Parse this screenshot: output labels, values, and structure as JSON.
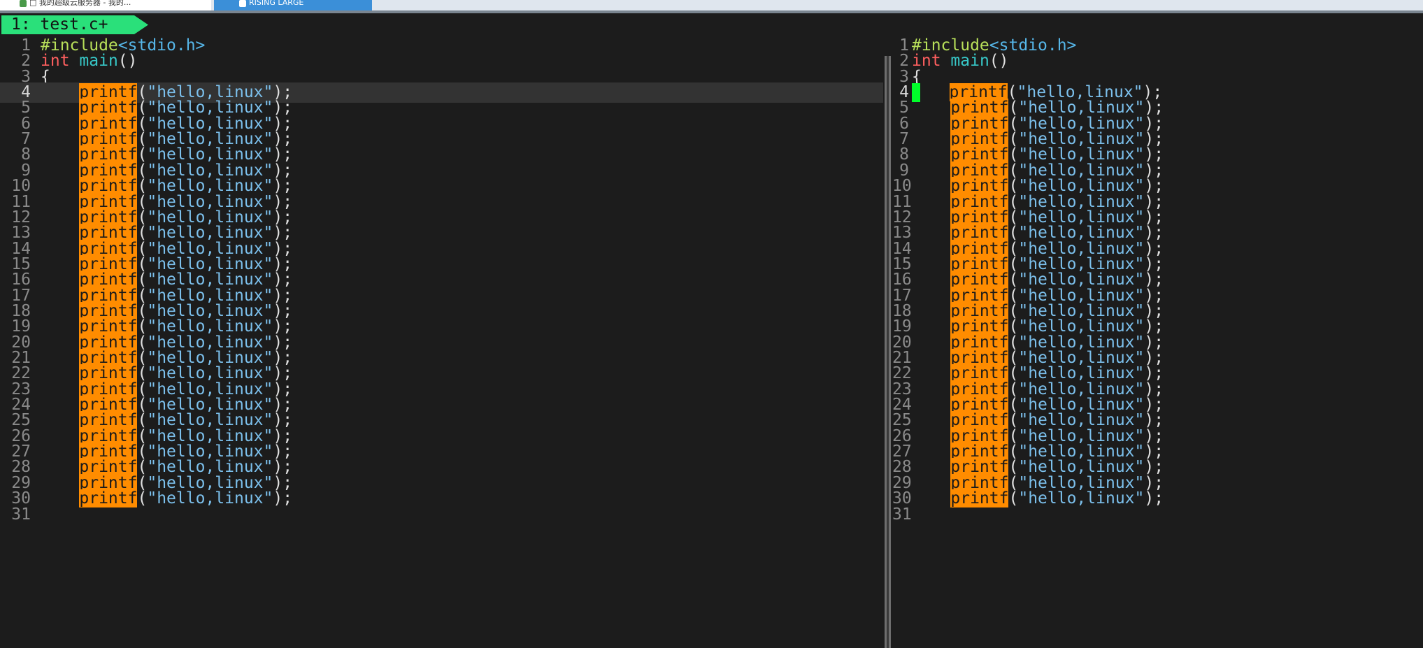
{
  "browser_tabs": [
    {
      "label": "□ 我的超级云服务器 - 我的..."
    },
    {
      "label": "RISING LARGE"
    }
  ],
  "vim_tab": {
    "label": "1: test.c+"
  },
  "colors": {
    "tab_active": "#2ae07a",
    "printf_highlight": "#ff8c00",
    "cursor": "#00ff2a",
    "background": "#1c1c1c"
  },
  "code": {
    "line1": {
      "pre": "#include",
      "inc": "<stdio.h>"
    },
    "line2": {
      "type": "int",
      "fn": "main",
      "paren": "()"
    },
    "line3": {
      "brace": "{"
    },
    "printf_line": {
      "fn": "printf",
      "open": "(",
      "str": "\"hello,linux\"",
      "close": ");"
    },
    "printf_count": 27,
    "cursor_line": 4,
    "indent": "    "
  },
  "panes": [
    {
      "name": "left",
      "current_line": 4
    },
    {
      "name": "right",
      "current_line": 4,
      "cursor": true
    }
  ]
}
